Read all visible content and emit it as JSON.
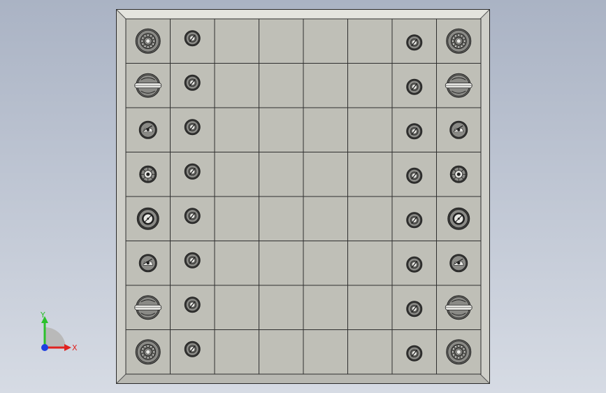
{
  "viewport": {
    "background_top": "#aab3c4",
    "background_bottom": "#d6dbe4"
  },
  "board": {
    "rows": 8,
    "cols": 8,
    "square_color": "#bfbfb7",
    "grid_line_color": "#2f2f2f",
    "frame_color": "#cfcfc9",
    "bevel_color": "#e4e4de",
    "setup": [
      [
        "rook",
        "pawn",
        "",
        "",
        "",
        "",
        "pawn",
        "rook"
      ],
      [
        "knight",
        "pawn",
        "",
        "",
        "",
        "",
        "pawn",
        "knight"
      ],
      [
        "bishop",
        "pawn",
        "",
        "",
        "",
        "",
        "pawn",
        "bishop"
      ],
      [
        "queen",
        "pawn",
        "",
        "",
        "",
        "",
        "pawn",
        "queen"
      ],
      [
        "king",
        "pawn",
        "",
        "",
        "",
        "",
        "pawn",
        "king"
      ],
      [
        "bishop",
        "pawn",
        "",
        "",
        "",
        "",
        "pawn",
        "bishop"
      ],
      [
        "knight",
        "pawn",
        "",
        "",
        "",
        "",
        "pawn",
        "knight"
      ],
      [
        "rook",
        "pawn",
        "",
        "",
        "",
        "",
        "pawn",
        "rook"
      ]
    ]
  },
  "piece_colors": {
    "body": "#8a8a86",
    "rim": "#3a3a38",
    "highlight": "#e8e8e4",
    "dark": "#202020"
  },
  "triad": {
    "x_label": "X",
    "y_label": "Y",
    "x_color": "#e0221f",
    "y_color": "#2cc12c",
    "z_color": "#1f3fe0",
    "arc_color": "#b9b9b9"
  }
}
